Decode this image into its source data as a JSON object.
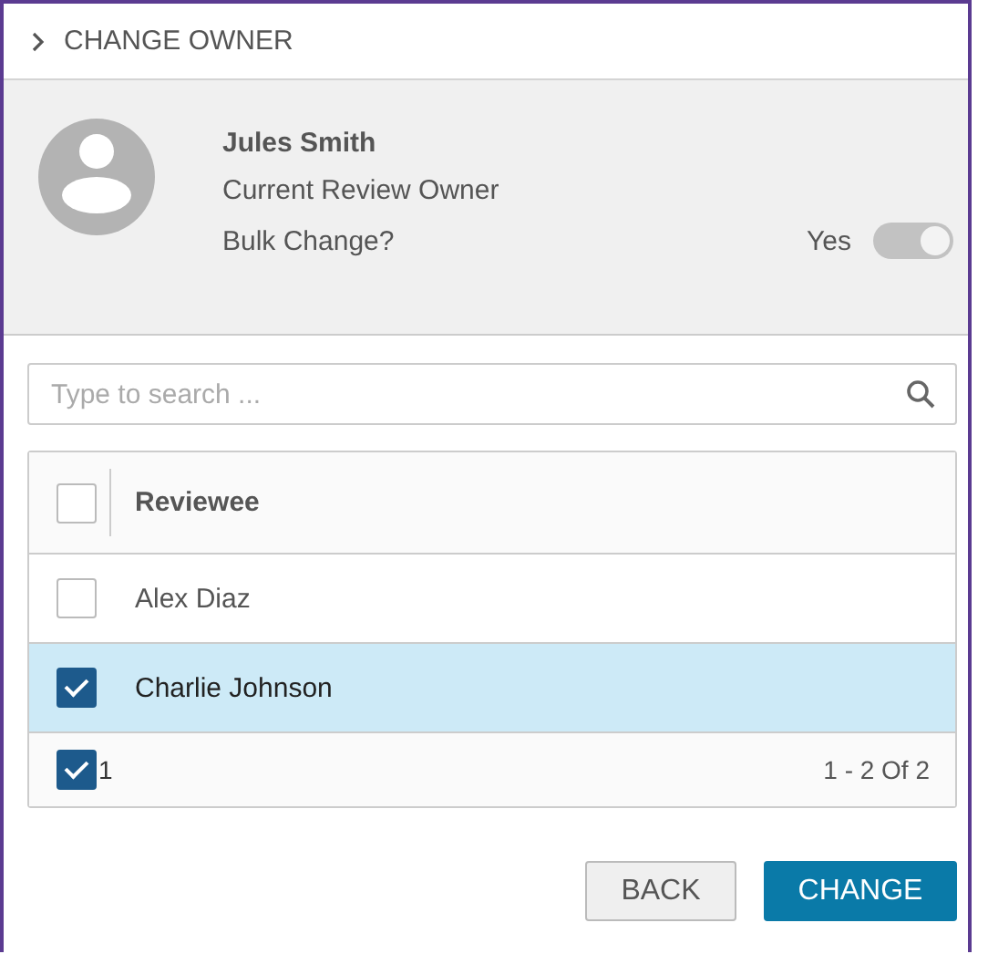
{
  "panel": {
    "title": "CHANGE OWNER"
  },
  "owner": {
    "name": "Jules Smith",
    "role": "Current Review Owner",
    "bulk_label": "Bulk Change?",
    "bulk_value": "Yes",
    "bulk_on": true
  },
  "search": {
    "placeholder": "Type to search ..."
  },
  "table": {
    "header_checked": false,
    "column": "Reviewee",
    "rows": [
      {
        "name": "Alex Diaz",
        "selected": false
      },
      {
        "name": "Charlie Johnson",
        "selected": true
      }
    ],
    "footer": {
      "checked": true,
      "count": "1",
      "range": "1 - 2 Of 2"
    }
  },
  "buttons": [
    {
      "label": "BACK",
      "kind": "secondary"
    },
    {
      "label": "CHANGE",
      "kind": "primary"
    }
  ]
}
